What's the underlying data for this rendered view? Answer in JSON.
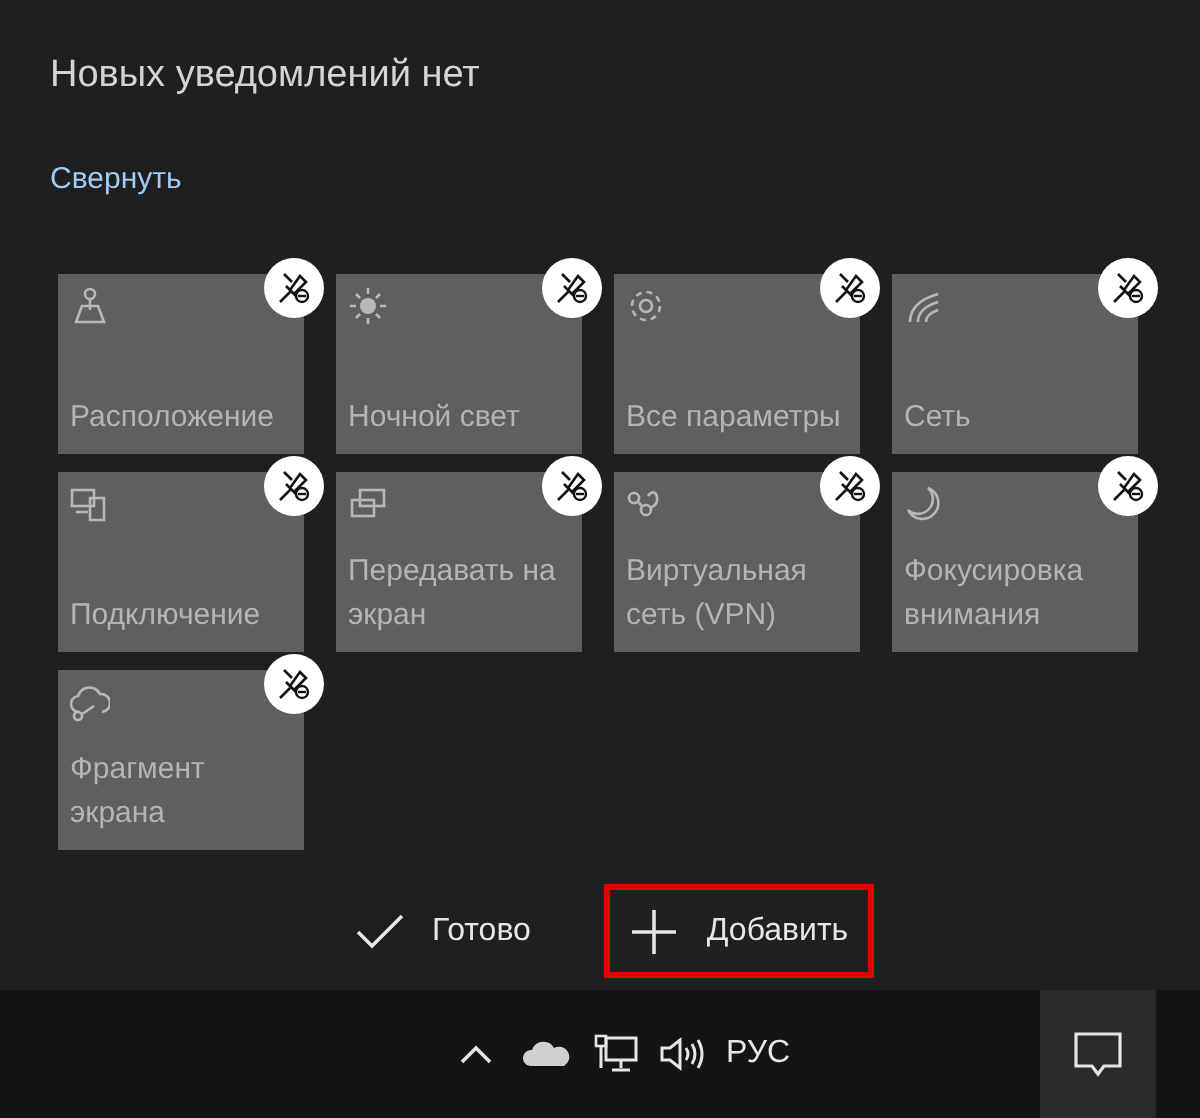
{
  "header": {
    "title": "Новых уведомлений нет"
  },
  "collapse_link": "Свернуть",
  "tiles": [
    {
      "label": "Расположение"
    },
    {
      "label": "Ночной свет"
    },
    {
      "label": "Все параметры"
    },
    {
      "label": "Сеть"
    },
    {
      "label": "Подключение"
    },
    {
      "label": "Передавать на экран"
    },
    {
      "label": "Виртуальная сеть (VPN)"
    },
    {
      "label": "Фокусировка внимания"
    },
    {
      "label": "Фрагмент экрана"
    }
  ],
  "actions": [
    {
      "label": "Готово",
      "kind": "done",
      "highlighted": false
    },
    {
      "label": "Добавить",
      "kind": "add",
      "highlighted": true
    }
  ],
  "taskbar": {
    "language": "РУС"
  }
}
